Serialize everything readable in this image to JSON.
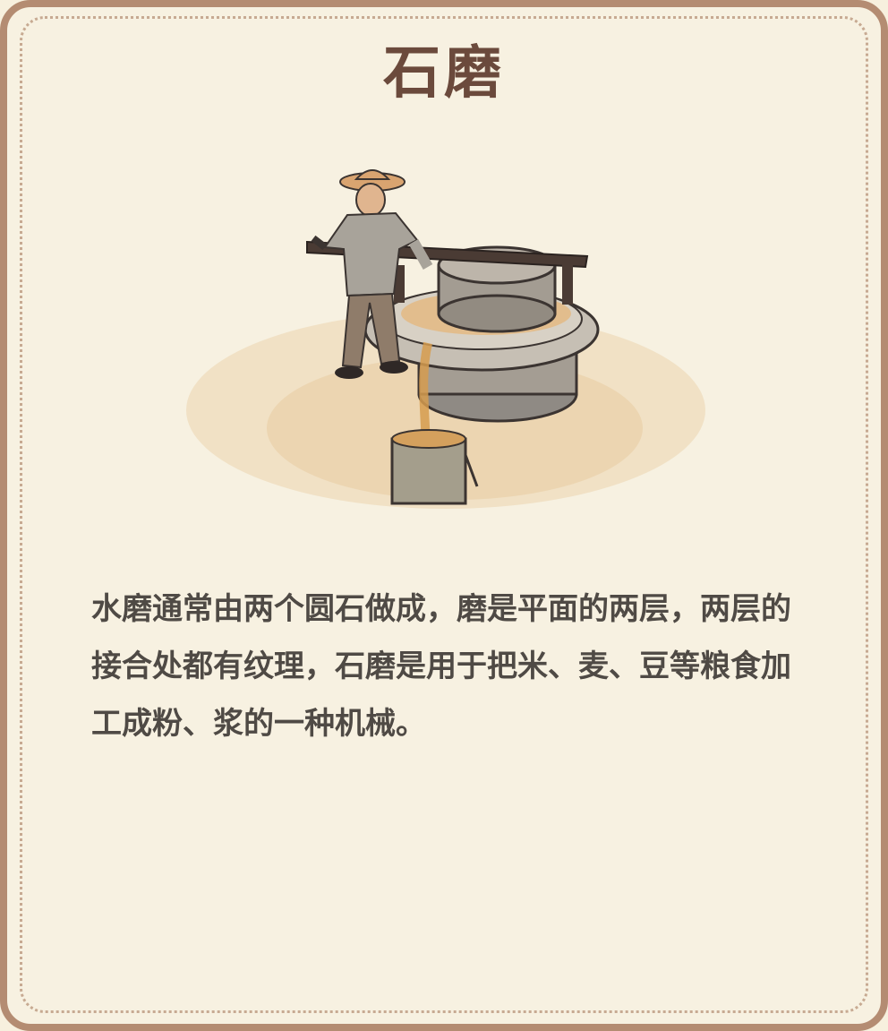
{
  "card": {
    "title": "石磨",
    "description": "水磨通常由两个圆石做成，磨是平面的两层，两层的接合处都有纹理，石磨是用于把米、麦、豆等粮食加工成粉、浆的一种机械。",
    "illustration_icon": "stone-mill-illustration"
  },
  "colors": {
    "border": "#b48c72",
    "background": "#f7f1e1",
    "title": "#6b4a3c",
    "text": "#4f4a45"
  }
}
